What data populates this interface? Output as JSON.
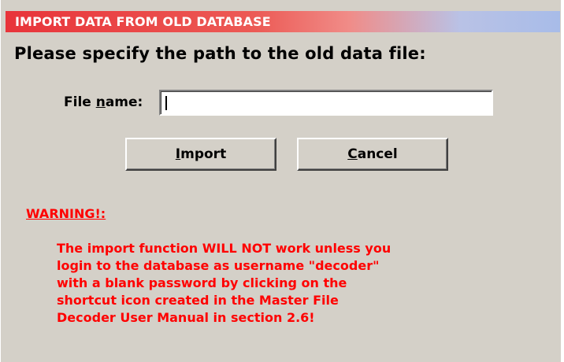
{
  "window": {
    "title": "IMPORT DATA FROM OLD DATABASE",
    "titlebar_colors": [
      "#e8343a",
      "#a8bce8"
    ],
    "background": "#d4d0c8"
  },
  "prompt": "Please specify the path to the old data file:",
  "file_field": {
    "label_prefix": "File ",
    "label_accel": "n",
    "label_suffix": "ame:",
    "value": ""
  },
  "buttons": {
    "import": {
      "accel": "I",
      "rest": "mport"
    },
    "cancel": {
      "accel": "C",
      "rest": "ancel"
    }
  },
  "warning": {
    "title": "WARNING!:",
    "color": "#ff0000",
    "lines": [
      "The import function WILL NOT work unless you",
      "login to the database as username \"decoder\"",
      "with a blank password by clicking on the",
      "shortcut icon created in the Master File",
      "Decoder User Manual in section 2.6!"
    ]
  }
}
